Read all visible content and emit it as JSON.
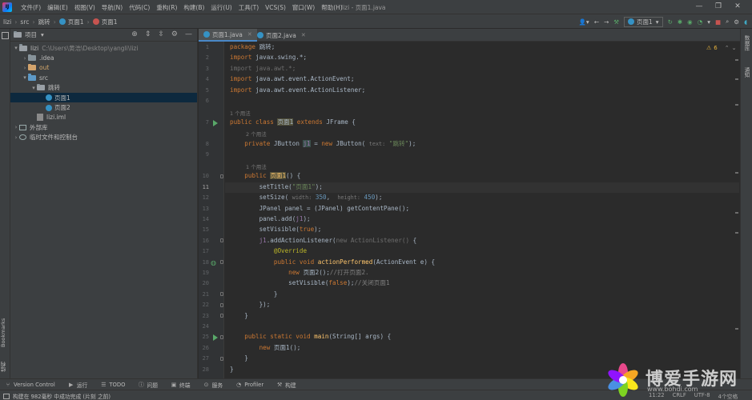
{
  "window": {
    "title": "lizi - 页面1.java",
    "menu": [
      "文件(F)",
      "编辑(E)",
      "视图(V)",
      "导航(N)",
      "代码(C)",
      "重构(R)",
      "构建(B)",
      "运行(U)",
      "工具(T)",
      "VCS(S)",
      "窗口(W)",
      "帮助(H)"
    ]
  },
  "navbar": {
    "breadcrumb": [
      "lizi",
      "src",
      "跳转",
      "页面1",
      "页面1"
    ],
    "run_config": "页面1"
  },
  "project": {
    "title": "项目",
    "tree": [
      {
        "label": "lizi",
        "extra": "C:\\Users\\黄浩\\Desktop\\yangli\\lizi"
      },
      {
        "label": ".idea"
      },
      {
        "label": "out"
      },
      {
        "label": "src"
      },
      {
        "label": "跳转"
      },
      {
        "label": "页面1"
      },
      {
        "label": "页面2"
      },
      {
        "label": "lizi.iml"
      },
      {
        "label": "外部库"
      },
      {
        "label": "临时文件和控制台"
      }
    ]
  },
  "tabs": [
    {
      "label": "页面1.java"
    },
    {
      "label": "页面2.java"
    }
  ],
  "editor": {
    "line_numbers": [
      "1",
      "2",
      "3",
      "4",
      "5",
      "6",
      "7",
      "8",
      "9",
      "10",
      "11",
      "12",
      "13",
      "14",
      "15",
      "16",
      "17",
      "18",
      "19",
      "20",
      "21",
      "22",
      "23",
      "24",
      "25",
      "26",
      "27",
      "28"
    ],
    "usage_hint_1": "1 个用法",
    "usage_hint_2": "2 个用法",
    "usage_hint_3": "1 个用法",
    "warnings": "6"
  },
  "left_strip": {
    "bookmarks": "Bookmarks",
    "structure": "结构"
  },
  "right_strip": {
    "database": "数据库",
    "notifications": "通知"
  },
  "bottom_tools": [
    "Version Control",
    "运行",
    "TODO",
    "问题",
    "终端",
    "服务",
    "Profiler",
    "构建"
  ],
  "status": {
    "message": "构建在 982毫秒 中成功完成 (片刻 之前)",
    "position": "11:22",
    "line_sep": "CRLF",
    "encoding": "UTF-8",
    "indent": "4个空格"
  },
  "watermark": {
    "text": "博爱手游网",
    "url": "www.bohdi.com"
  },
  "colors": {
    "accent": "#4a88c7",
    "run": "#59a869",
    "keyword": "#cc7832",
    "string": "#6a8759",
    "number": "#6897bb",
    "method": "#ffc66d",
    "annotation": "#bbb529"
  }
}
